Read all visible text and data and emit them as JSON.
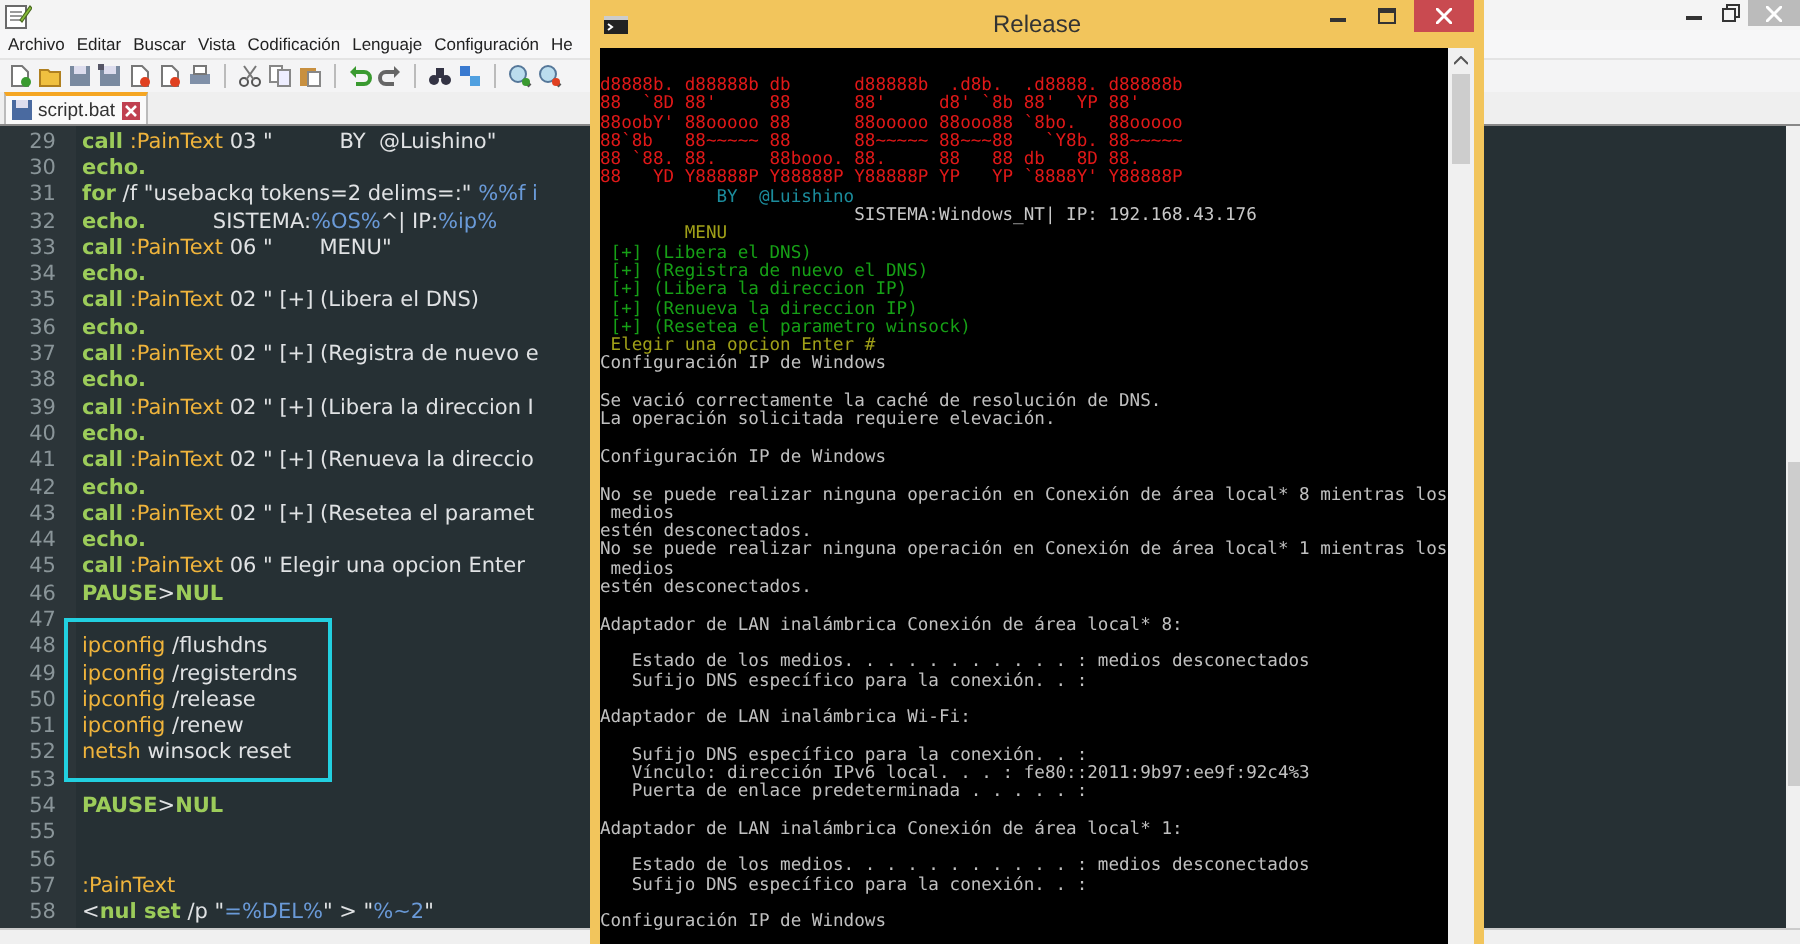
{
  "editor": {
    "menu": [
      "Archivo",
      "Editar",
      "Buscar",
      "Vista",
      "Codificación",
      "Lenguaje",
      "Configuración",
      "He"
    ],
    "tabs": [
      {
        "label": "script.bat",
        "selected": true
      }
    ],
    "blocks": [
      {
        "boxed": false,
        "lines": [
          {
            "number": "29",
            "tokens": [
              {
                "kind": "kw",
                "text": "call"
              },
              {
                "kind": "label",
                "text": " :PainText"
              },
              {
                "kind": "text",
                "text": " 03 \"          BY  @Luishino\""
              }
            ]
          },
          {
            "number": "30",
            "tokens": [
              {
                "kind": "kw",
                "text": "echo."
              }
            ]
          },
          {
            "number": "31",
            "tokens": [
              {
                "kind": "kw",
                "text": "for"
              },
              {
                "kind": "text",
                "text": " /f \"usebackq tokens=2 delims=:\" "
              },
              {
                "kind": "var",
                "text": "%%f i"
              }
            ]
          },
          {
            "number": "32",
            "tokens": [
              {
                "kind": "kw",
                "text": "echo."
              },
              {
                "kind": "text",
                "text": "          SISTEMA:"
              },
              {
                "kind": "var",
                "text": "%OS%"
              },
              {
                "kind": "text",
                "text": "^| IP:"
              },
              {
                "kind": "var",
                "text": "%ip%"
              }
            ]
          },
          {
            "number": "33",
            "tokens": [
              {
                "kind": "kw",
                "text": "call"
              },
              {
                "kind": "label",
                "text": " :PainText"
              },
              {
                "kind": "text",
                "text": " 06 \"       MENU\""
              }
            ]
          },
          {
            "number": "34",
            "tokens": [
              {
                "kind": "kw",
                "text": "echo."
              }
            ]
          },
          {
            "number": "35",
            "tokens": [
              {
                "kind": "kw",
                "text": "call"
              },
              {
                "kind": "label",
                "text": " :PainText"
              },
              {
                "kind": "text",
                "text": " 02 \" [+] (Libera el DNS)"
              }
            ]
          },
          {
            "number": "36",
            "tokens": [
              {
                "kind": "kw",
                "text": "echo."
              }
            ]
          },
          {
            "number": "37",
            "tokens": [
              {
                "kind": "kw",
                "text": "call"
              },
              {
                "kind": "label",
                "text": " :PainText"
              },
              {
                "kind": "text",
                "text": " 02 \" [+] (Registra de nuevo e"
              }
            ]
          },
          {
            "number": "38",
            "tokens": [
              {
                "kind": "kw",
                "text": "echo."
              }
            ]
          },
          {
            "number": "39",
            "tokens": [
              {
                "kind": "kw",
                "text": "call"
              },
              {
                "kind": "label",
                "text": " :PainText"
              },
              {
                "kind": "text",
                "text": " 02 \" [+] (Libera la direccion I"
              }
            ]
          },
          {
            "number": "40",
            "tokens": [
              {
                "kind": "kw",
                "text": "echo."
              }
            ]
          },
          {
            "number": "41",
            "tokens": [
              {
                "kind": "kw",
                "text": "call"
              },
              {
                "kind": "label",
                "text": " :PainText"
              },
              {
                "kind": "text",
                "text": " 02 \" [+] (Renueva la direccio"
              }
            ]
          },
          {
            "number": "42",
            "tokens": [
              {
                "kind": "kw",
                "text": "echo."
              }
            ]
          },
          {
            "number": "43",
            "tokens": [
              {
                "kind": "kw",
                "text": "call"
              },
              {
                "kind": "label",
                "text": " :PainText"
              },
              {
                "kind": "text",
                "text": " 02 \" [+] (Resetea el paramet"
              }
            ]
          },
          {
            "number": "44",
            "tokens": [
              {
                "kind": "kw",
                "text": "echo."
              }
            ]
          },
          {
            "number": "45",
            "tokens": [
              {
                "kind": "kw",
                "text": "call"
              },
              {
                "kind": "label",
                "text": " :PainText"
              },
              {
                "kind": "text",
                "text": " 06 \" Elegir una opcion Enter"
              }
            ]
          },
          {
            "number": "46",
            "tokens": [
              {
                "kind": "kw",
                "text": "PAUSE"
              },
              {
                "kind": "text",
                "text": ">"
              },
              {
                "kind": "kw",
                "text": "NUL"
              }
            ]
          },
          {
            "number": "47"
          }
        ]
      },
      {
        "boxed": true,
        "lines": [
          {
            "number": "48",
            "tokens": [
              {
                "kind": "label",
                "text": "ipconfig"
              },
              {
                "kind": "text",
                "text": " /flushdns"
              }
            ]
          },
          {
            "number": "49",
            "tokens": [
              {
                "kind": "label",
                "text": "ipconfig"
              },
              {
                "kind": "text",
                "text": " /registerdns"
              }
            ]
          },
          {
            "number": "50",
            "tokens": [
              {
                "kind": "label",
                "text": "ipconfig"
              },
              {
                "kind": "text",
                "text": " /release"
              }
            ]
          },
          {
            "number": "51",
            "tokens": [
              {
                "kind": "label",
                "text": "ipconfig"
              },
              {
                "kind": "text",
                "text": " /renew"
              }
            ]
          },
          {
            "number": "52",
            "tokens": [
              {
                "kind": "label",
                "text": "netsh"
              },
              {
                "kind": "text",
                "text": " winsock reset"
              }
            ]
          }
        ]
      },
      {
        "boxed": false,
        "lines": [
          {
            "number": "53"
          },
          {
            "number": "54",
            "tokens": [
              {
                "kind": "kw",
                "text": "PAUSE"
              },
              {
                "kind": "text",
                "text": ">"
              },
              {
                "kind": "kw",
                "text": "NUL"
              }
            ]
          },
          {
            "number": "55"
          },
          {
            "number": "56"
          },
          {
            "number": "57",
            "tokens": [
              {
                "kind": "label",
                "text": ":PainText"
              }
            ]
          },
          {
            "number": "58",
            "tokens": [
              {
                "kind": "text",
                "text": "<"
              },
              {
                "kind": "kw",
                "text": "nul set"
              },
              {
                "kind": "text",
                "text": " /p \""
              },
              {
                "kind": "var",
                "text": "=%DEL%"
              },
              {
                "kind": "text",
                "text": "\" > \""
              },
              {
                "kind": "var",
                "text": "%~2"
              },
              {
                "kind": "text",
                "text": "\""
              }
            ]
          }
        ]
      }
    ]
  },
  "console": {
    "title": "Release",
    "lines": [
      {
        "kind": "art",
        "text": "d8888b. d88888b db      d88888b  .d8b.  .d8888. d88888b"
      },
      {
        "kind": "art",
        "text": "88  `8D 88'     88      88'     d8' `8b 88'  YP 88'"
      },
      {
        "kind": "art",
        "text": "88oobY' 88ooooo 88      88ooooo 88ooo88 `8bo.   88ooooo"
      },
      {
        "kind": "art",
        "text": "88`8b   88~~~~~ 88      88~~~~~ 88~~~88   `Y8b. 88~~~~~"
      },
      {
        "kind": "art",
        "text": "88 `88. 88.     88booo. 88.     88   88 db   8D 88."
      },
      {
        "kind": "art",
        "text": "88   YD Y88888P Y88888P Y88888P YP   YP `8888Y' Y88888P"
      },
      {
        "kind": "author",
        "text": "           BY  @Luishino"
      },
      {
        "kind": "system",
        "text": "                        SISTEMA:Windows_NT| IP: 192.168.43.176"
      },
      {
        "kind": "menu",
        "text": "        MENU"
      },
      {
        "kind": "option",
        "text": " [+] (Libera el DNS)"
      },
      {
        "kind": "option",
        "text": " [+] (Registra de nuevo el DNS)"
      },
      {
        "kind": "option",
        "text": " [+] (Libera la direccion IP)"
      },
      {
        "kind": "option",
        "text": " [+] (Renueva la direccion IP)"
      },
      {
        "kind": "option",
        "text": " [+] (Resetea el parametro winsock)"
      },
      {
        "kind": "prompt",
        "text": " Elegir una opcion Enter #"
      },
      {
        "kind": "output",
        "text": "Configuración IP de Windows"
      },
      {
        "kind": "blank"
      },
      {
        "kind": "output",
        "text": "Se vació correctamente la caché de resolución de DNS."
      },
      {
        "kind": "output",
        "text": "La operación solicitada requiere elevación."
      },
      {
        "kind": "blank"
      },
      {
        "kind": "output",
        "text": "Configuración IP de Windows"
      },
      {
        "kind": "blank"
      },
      {
        "kind": "output",
        "text": "No se puede realizar ninguna operación en Conexión de área local* 8 mientras los"
      },
      {
        "kind": "output",
        "text": " medios"
      },
      {
        "kind": "output",
        "text": "estén desconectados."
      },
      {
        "kind": "output",
        "text": "No se puede realizar ninguna operación en Conexión de área local* 1 mientras los"
      },
      {
        "kind": "output",
        "text": " medios"
      },
      {
        "kind": "output",
        "text": "estén desconectados."
      },
      {
        "kind": "blank"
      },
      {
        "kind": "output",
        "text": "Adaptador de LAN inalámbrica Conexión de área local* 8:"
      },
      {
        "kind": "blank"
      },
      {
        "kind": "output",
        "text": "   Estado de los medios. . . . . . . . . . . : medios desconectados"
      },
      {
        "kind": "output",
        "text": "   Sufijo DNS específico para la conexión. . :"
      },
      {
        "kind": "blank"
      },
      {
        "kind": "output",
        "text": "Adaptador de LAN inalámbrica Wi-Fi:"
      },
      {
        "kind": "blank"
      },
      {
        "kind": "output",
        "text": "   Sufijo DNS específico para la conexión. . :"
      },
      {
        "kind": "output",
        "text": "   Vínculo: dirección IPv6 local. . . : fe80::2011:9b97:ee9f:92c4%3"
      },
      {
        "kind": "output",
        "text": "   Puerta de enlace predeterminada . . . . . :"
      },
      {
        "kind": "blank"
      },
      {
        "kind": "output",
        "text": "Adaptador de LAN inalámbrica Conexión de área local* 1:"
      },
      {
        "kind": "blank"
      },
      {
        "kind": "output",
        "text": "   Estado de los medios. . . . . . . . . . . : medios desconectados"
      },
      {
        "kind": "output",
        "text": "   Sufijo DNS específico para la conexión. . :"
      },
      {
        "kind": "blank"
      },
      {
        "kind": "output",
        "text": "Configuración IP de Windows"
      }
    ]
  }
}
